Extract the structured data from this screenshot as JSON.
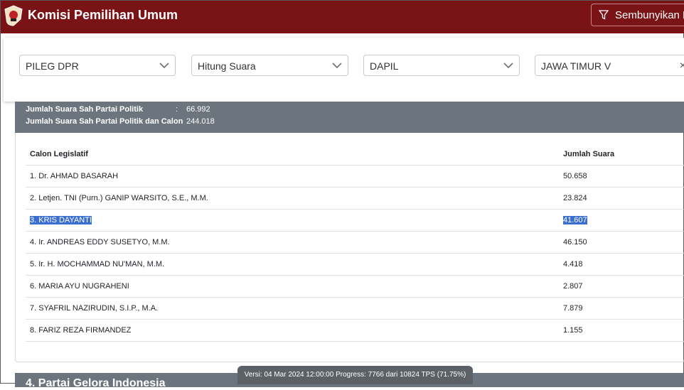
{
  "header": {
    "brand": "Komisi Pemilihan Umum",
    "filter_button_label": "Sembunyikan Fi",
    "bg_color": "#7a1315"
  },
  "filters": {
    "election_type": "PILEG DPR",
    "view_mode": "Hitung Suara",
    "area_level": "DAPIL",
    "area": "JAWA TIMUR V"
  },
  "summary": {
    "party_valid_label": "Jumlah Suara Sah Partai Politik",
    "party_valid_value": "66.992",
    "total_valid_label": "Jumlah Suara Sah Partai Politik dan Calon",
    "total_valid_value": "244.018",
    "colon": ":"
  },
  "table": {
    "headers": [
      "Calon Legislatif",
      "Jumlah Suara"
    ],
    "rows": [
      {
        "name": "1. Dr. AHMAD BASARAH",
        "votes": "50.658"
      },
      {
        "name": "2. Letjen. TNI (Purn.) GANIP WARSITO, S.E., M.M.",
        "votes": "23.824"
      },
      {
        "name": "3. KRIS DAYANTI",
        "votes": "41.607",
        "selected": true
      },
      {
        "name": "4. Ir. ANDREAS EDDY SUSETYO, M.M.",
        "votes": "46.150"
      },
      {
        "name": "5. Ir. H. MOCHAMMAD NU'MAN, M.M.",
        "votes": "4.418"
      },
      {
        "name": "6. MARIA AYU NUGRAHENI",
        "votes": "2.807"
      },
      {
        "name": "7. SYAFRIL NAZIRUDIN, S.I.P., M.A.",
        "votes": "7.879"
      },
      {
        "name": "8. FARIZ REZA FIRMANDEZ",
        "votes": "1.155"
      }
    ]
  },
  "next_section_title": "4. Partai Gelora Indonesia",
  "version_text": "Versi: 04 Mar 2024 12:00:00 Progress: 7766 dari 10824 TPS (71.75%)",
  "icons": {
    "logo": "kpu-logo-icon",
    "filter": "filter-icon",
    "chevron": "chevron-down-icon",
    "clear": "clear-icon"
  }
}
